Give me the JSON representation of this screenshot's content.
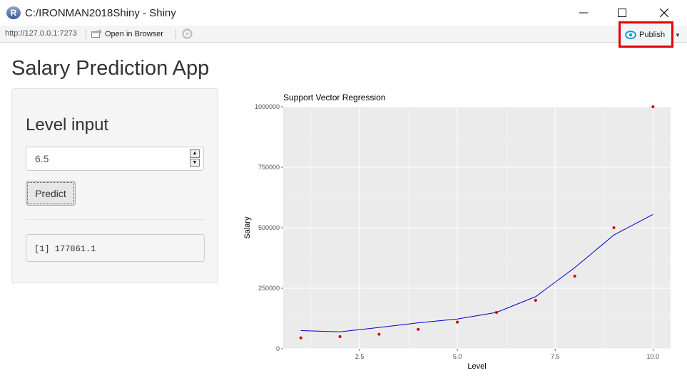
{
  "window": {
    "title": "C:/IRONMAN2018Shiny - Shiny",
    "logo_letter": "R",
    "icons": [
      "r-logo-icon",
      "minimize-icon",
      "maximize-icon",
      "close-icon"
    ]
  },
  "toolbar": {
    "url": "http://127.0.0.1:7273",
    "open_in_browser": "Open in Browser",
    "publish": "Publish",
    "icons": [
      "open-browser-icon",
      "refresh-icon",
      "publish-icon",
      "chevron-down-icon"
    ]
  },
  "app": {
    "title": "Salary Prediction App",
    "input_label": "Level input",
    "input_value": "6.5",
    "predict_label": "Predict",
    "output_text": "[1] 177861.1"
  },
  "colors": {
    "points": "#cc0000",
    "line": "#0000cc",
    "panel_bg": "#ebebeb",
    "highlight_box": "#e60000"
  },
  "chart_data": {
    "type": "scatter",
    "title": "Support Vector Regression",
    "xlabel": "Level",
    "ylabel": "Salary",
    "xlim": [
      0.55,
      10.45
    ],
    "ylim": [
      0,
      1000000
    ],
    "x_ticks": [
      2.5,
      5.0,
      7.5,
      10.0
    ],
    "x_tick_labels": [
      "2.5",
      "5.0",
      "7.5",
      "10.0"
    ],
    "y_ticks": [
      0,
      250000,
      500000,
      750000,
      1000000
    ],
    "y_tick_labels": [
      "0",
      "250000",
      "500000",
      "750000",
      "1000000"
    ],
    "grid": true,
    "points": {
      "x": [
        1,
        2,
        3,
        4,
        5,
        6,
        7,
        8,
        9,
        10
      ],
      "y": [
        45000,
        50000,
        60000,
        80000,
        110000,
        150000,
        200000,
        300000,
        500000,
        1000000
      ]
    },
    "line": {
      "x": [
        1,
        2,
        3,
        4,
        5,
        6,
        7,
        8,
        9,
        10
      ],
      "y": [
        75000,
        70000,
        88000,
        107000,
        123000,
        150000,
        215000,
        335000,
        470000,
        555000
      ]
    }
  }
}
